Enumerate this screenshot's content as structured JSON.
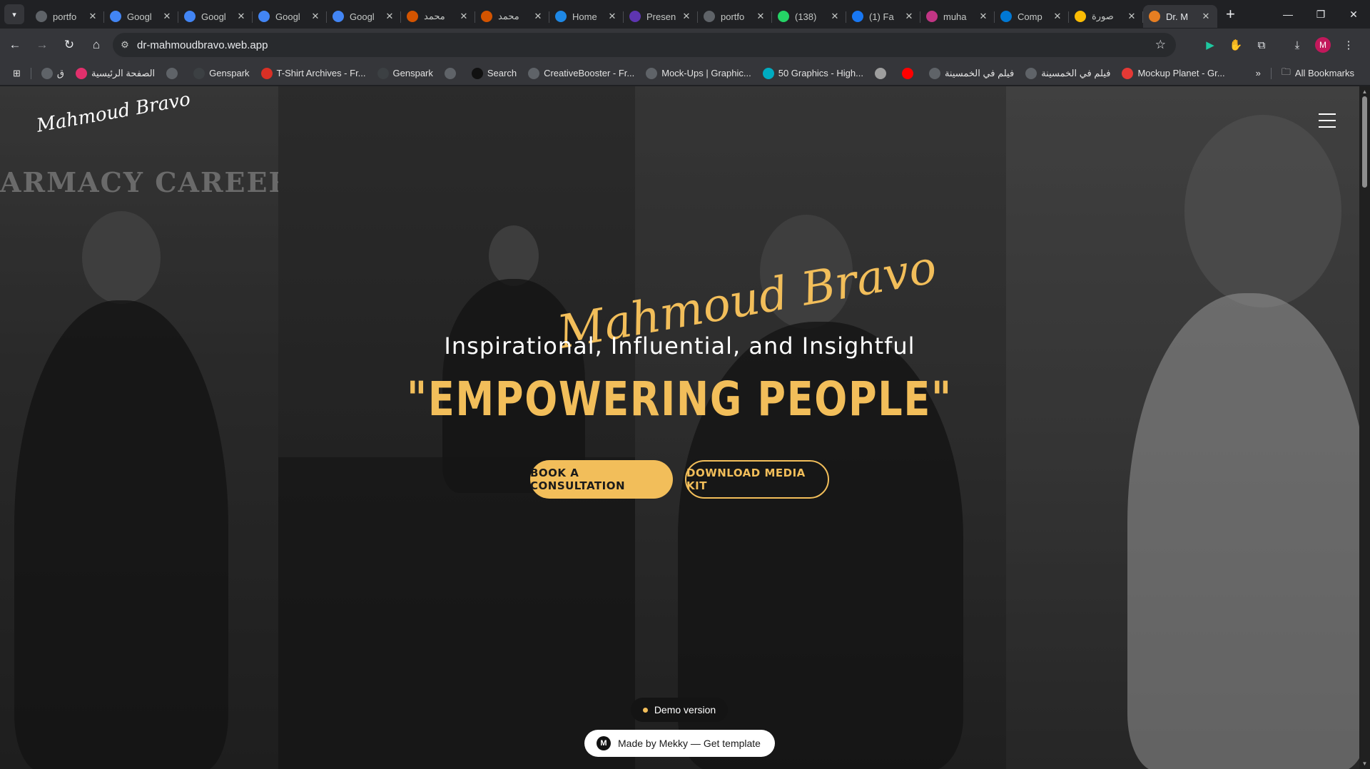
{
  "browser": {
    "tabs": [
      {
        "title": "portfo",
        "icon": "openai-icon",
        "color": "#5f6368"
      },
      {
        "title": "Googl",
        "icon": "gemini-icon",
        "color": "#4285f4"
      },
      {
        "title": "Googl",
        "icon": "gemini-icon",
        "color": "#4285f4"
      },
      {
        "title": "Googl",
        "icon": "gemini-icon",
        "color": "#4285f4"
      },
      {
        "title": "Googl",
        "icon": "gemini-icon",
        "color": "#4285f4"
      },
      {
        "title": "محمد",
        "icon": "ai-avatar-icon",
        "color": "#d35400"
      },
      {
        "title": "محمد",
        "icon": "ai-avatar-icon",
        "color": "#d35400"
      },
      {
        "title": "Home",
        "icon": "canva-icon",
        "color": "#1e88e5"
      },
      {
        "title": "Presen",
        "icon": "shield-icon",
        "color": "#5e35b1"
      },
      {
        "title": "portfo",
        "icon": "openai-icon",
        "color": "#5f6368"
      },
      {
        "title": "(138)",
        "icon": "whatsapp-icon",
        "color": "#25d366"
      },
      {
        "title": "(1) Fa",
        "icon": "facebook-icon",
        "color": "#1877f2"
      },
      {
        "title": "muha",
        "icon": "instagram-icon",
        "color": "#c13584"
      },
      {
        "title": "Comp",
        "icon": "edge-icon",
        "color": "#0078d4"
      },
      {
        "title": "صورة",
        "icon": "google-photos-icon",
        "color": "#fbbc04"
      },
      {
        "title": "Dr. M",
        "icon": "site-favicon-icon",
        "color": "#e67e22",
        "active": true
      }
    ],
    "new_tab": "+",
    "url": "dr-mahmoudbravo.web.app",
    "bookmarks": [
      {
        "label": "ق",
        "icon": "folder-icon",
        "color": "#5f6368"
      },
      {
        "label": "الصفحة الرئيسية",
        "icon": "instagram-icon",
        "color": "#e1306c"
      },
      {
        "label": "",
        "icon": "globe-icon",
        "color": "#5f6368"
      },
      {
        "label": "Genspark",
        "icon": "genspark-icon",
        "color": "#3c4043"
      },
      {
        "label": "T-Shirt Archives - Fr...",
        "icon": "red-circle-icon",
        "color": "#d93025"
      },
      {
        "label": "Genspark",
        "icon": "genspark-icon",
        "color": "#3c4043"
      },
      {
        "label": "",
        "icon": "globe-icon",
        "color": "#5f6368"
      },
      {
        "label": "Search",
        "icon": "m-icon",
        "color": "#111111"
      },
      {
        "label": "CreativeBooster - Fr...",
        "icon": "square-icon",
        "color": "#5f6368"
      },
      {
        "label": "Mock-Ups | Graphic...",
        "icon": "grid-icon",
        "color": "#5f6368"
      },
      {
        "label": "50 Graphics - High...",
        "icon": "teal-square-icon",
        "color": "#00acc1"
      },
      {
        "label": "",
        "icon": "image-icon",
        "color": "#9e9e9e"
      },
      {
        "label": "",
        "icon": "youtube-icon",
        "color": "#ff0000"
      },
      {
        "label": "فيلم في الخمسينة",
        "icon": "globe-icon",
        "color": "#5f6368"
      },
      {
        "label": "فيلم في الخمسينة",
        "icon": "globe-icon",
        "color": "#5f6368"
      },
      {
        "label": "Mockup Planet - Gr...",
        "icon": "planet-icon",
        "color": "#e53935"
      }
    ],
    "more_bookmarks": "»",
    "all_bookmarks": "All Bookmarks",
    "profile_initial": "M"
  },
  "site": {
    "logo_small": "Mahmoud Bravo",
    "logo_large": "Mahmoud Bravo",
    "background_banner": "ARMACY CAREER",
    "tagline": "Inspirational, Influential, and Insightful",
    "headline": "\"EMPOWERING PEOPLE\"",
    "primary_cta": "BOOK A CONSULTATION",
    "secondary_cta": "DOWNLOAD MEDIA KIT",
    "demo_label": "Demo version",
    "made_by": "Made by Mekky — Get template",
    "made_by_initial": "M",
    "accent_color": "#f2be5a"
  }
}
